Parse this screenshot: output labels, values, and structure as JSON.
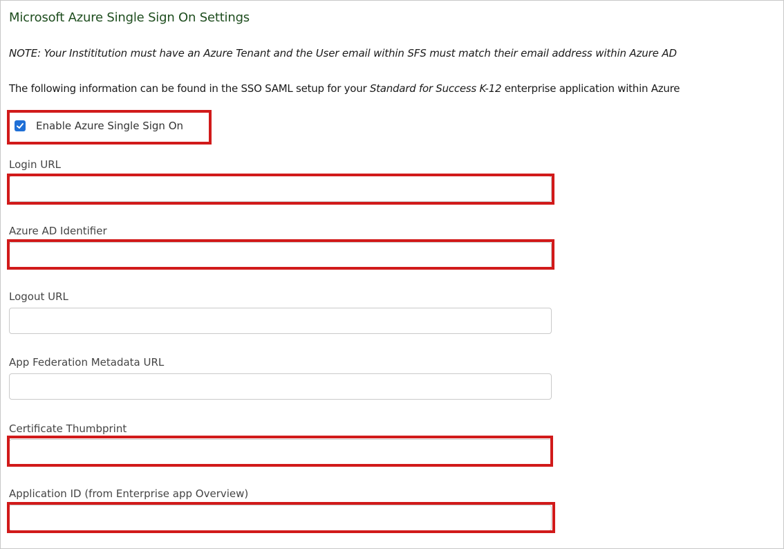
{
  "title": "Microsoft Azure Single Sign On Settings",
  "note": "NOTE: Your Instititution must have an Azure Tenant and the User email within SFS must match their email address within Azure AD",
  "info": {
    "prefix": "The following information can be found in the SSO SAML setup for your ",
    "app_name": "Standard for Success K-12",
    "suffix": " enterprise application within Azure"
  },
  "enable_sso": {
    "label": "Enable Azure Single Sign On",
    "checked": true
  },
  "fields": {
    "login_url": {
      "label": "Login URL",
      "value": ""
    },
    "azure_ad_identifier": {
      "label": "Azure AD Identifier",
      "value": ""
    },
    "logout_url": {
      "label": "Logout URL",
      "value": ""
    },
    "app_federation_metadata_url": {
      "label": "App Federation Metadata URL",
      "value": ""
    },
    "certificate_thumbprint": {
      "label": "Certificate Thumbprint",
      "value": ""
    },
    "application_id": {
      "label": "Application ID (from Enterprise app Overview)",
      "value": ""
    }
  },
  "colors": {
    "title": "#1e4d1e",
    "highlight": "#d11a1a",
    "checkbox": "#1f6fd6"
  }
}
